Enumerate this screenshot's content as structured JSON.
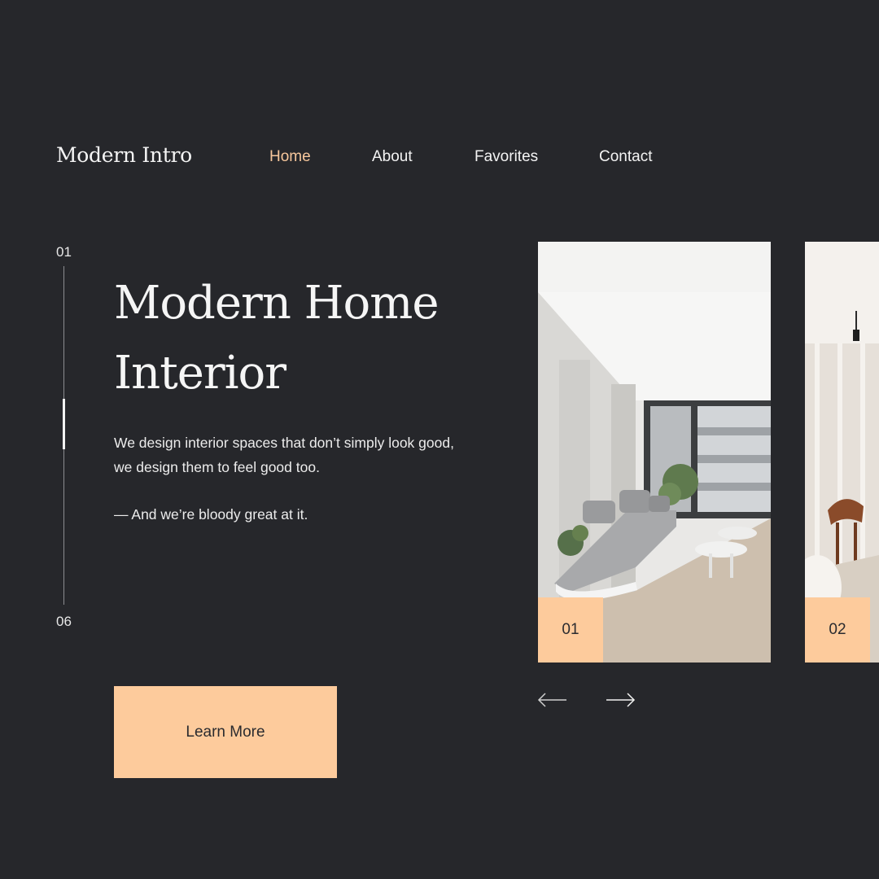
{
  "brand": {
    "name": "Modern Intro"
  },
  "nav": {
    "items": [
      {
        "label": "Home",
        "active": true
      },
      {
        "label": "About",
        "active": false
      },
      {
        "label": "Favorites",
        "active": false
      },
      {
        "label": "Contact",
        "active": false
      }
    ]
  },
  "slider": {
    "current": "01",
    "total": "06",
    "progress": 0.33
  },
  "hero": {
    "title_line1": "Modern Home",
    "title_line2": "Interior",
    "description": "We design interior spaces that don’t simply look good, we design them to feel good too.",
    "tagline": "— And we’re bloody great at it.",
    "cta_label": "Learn More"
  },
  "gallery": {
    "cards": [
      {
        "number": "01",
        "image": "living-room-photo"
      },
      {
        "number": "02",
        "image": "dining-room-photo"
      }
    ],
    "prev_icon": "arrow-left-icon",
    "next_icon": "arrow-right-icon"
  },
  "colors": {
    "background": "#26272b",
    "accent": "#fdcb9c",
    "active_nav": "#f7c79c",
    "text": "#f2f2f2"
  }
}
